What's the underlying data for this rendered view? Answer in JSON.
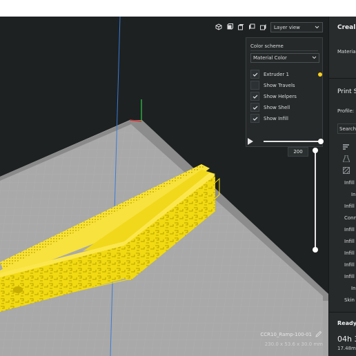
{
  "viewport": {
    "view_select": "Layer view",
    "view_icons": [
      "3d-view-icon",
      "front-view-icon",
      "top-view-icon",
      "left-view-icon",
      "right-view-icon"
    ],
    "color_scheme_label": "Color scheme",
    "color_scheme_value": "Material Color",
    "options": [
      {
        "label": "Extruder 1",
        "checked": true,
        "swatch": "#f9d01e"
      },
      {
        "label": "Show Travels",
        "checked": false
      },
      {
        "label": "Show Helpers",
        "checked": true
      },
      {
        "label": "Show Shell",
        "checked": true
      },
      {
        "label": "Show Infill",
        "checked": true
      }
    ],
    "layer_number": "200",
    "object_name": "CCR10_Ramp-100-01",
    "object_dims": "230.0 x 53.6 x 30.0 mm"
  },
  "right_panel": {
    "printer_name": "Creality",
    "material_label": "Material",
    "print_settings_title": "Print S",
    "profile_label": "Profile:",
    "search_placeholder": "Search...",
    "settings": [
      "Infill",
      "In",
      "Infill",
      "Conn",
      "Infill",
      "Infill",
      "Infill",
      "Infill",
      "Infill",
      "In",
      "Skin"
    ],
    "ready_label": "Ready t",
    "print_time": "04h 3",
    "material_length": "17.48m"
  },
  "colors": {
    "model_yellow": "#f5dc14",
    "bed_grey": "#a0a0a0",
    "background": "#1d2122",
    "panel": "#25292a"
  }
}
